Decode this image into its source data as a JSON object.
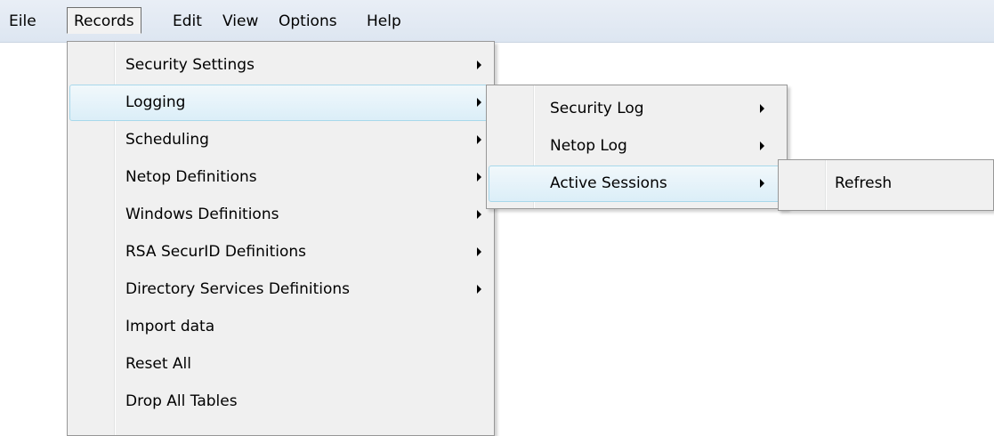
{
  "menubar": {
    "items": [
      {
        "label": "Eile"
      },
      {
        "label": "Records"
      },
      {
        "label": "Edit"
      },
      {
        "label": "View"
      },
      {
        "label": "Options"
      },
      {
        "label": "Help"
      }
    ]
  },
  "records_menu": {
    "items": [
      {
        "label": "Security Settings",
        "submenu": true
      },
      {
        "label": "Logging",
        "submenu": true,
        "highlighted": true
      },
      {
        "label": "Scheduling",
        "submenu": true
      },
      {
        "label": "Netop Definitions",
        "submenu": true
      },
      {
        "label": "Windows Definitions",
        "submenu": true
      },
      {
        "label": "RSA SecurID Definitions",
        "submenu": true
      },
      {
        "label": "Directory Services Definitions",
        "submenu": true
      },
      {
        "label": "Import data",
        "submenu": false
      },
      {
        "label": "Reset All",
        "submenu": false
      },
      {
        "label": "Drop All Tables",
        "submenu": false
      }
    ]
  },
  "logging_menu": {
    "items": [
      {
        "label": "Security Log",
        "submenu": true
      },
      {
        "label": "Netop Log",
        "submenu": true
      },
      {
        "label": "Active Sessions",
        "submenu": true,
        "highlighted": true
      }
    ]
  },
  "active_sessions_menu": {
    "items": [
      {
        "label": "Refresh",
        "submenu": false
      }
    ]
  },
  "colors": {
    "menubar_bg": "#e3eaf4",
    "menu_bg": "#f0f0f0",
    "highlight_border": "#a8d8eb",
    "highlight_bg": "#e4f2f9"
  }
}
